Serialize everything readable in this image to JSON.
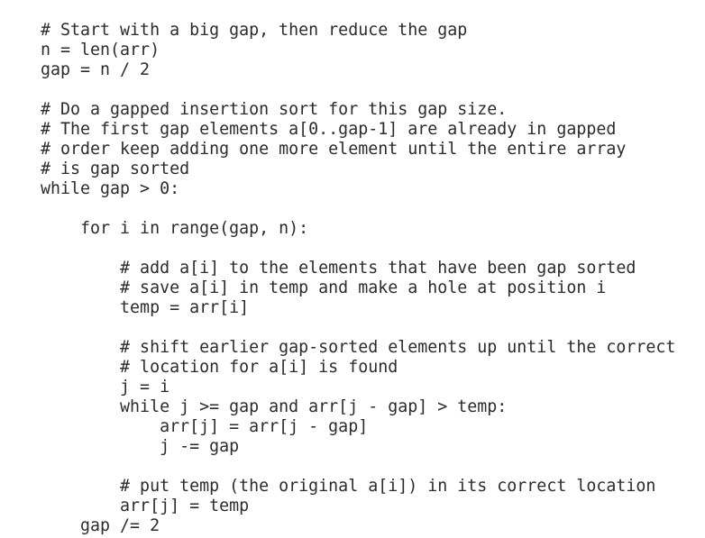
{
  "code": {
    "language": "python",
    "lines": [
      "# Start with a big gap, then reduce the gap",
      "n = len(arr)",
      "gap = n / 2",
      "",
      "# Do a gapped insertion sort for this gap size.",
      "# The first gap elements a[0..gap-1] are already in gapped",
      "# order keep adding one more element until the entire array",
      "# is gap sorted",
      "while gap > 0:",
      "",
      "    for i in range(gap, n):",
      "",
      "        # add a[i] to the elements that have been gap sorted",
      "        # save a[i] in temp and make a hole at position i",
      "        temp = arr[i]",
      "",
      "        # shift earlier gap-sorted elements up until the correct",
      "        # location for a[i] is found",
      "        j = i",
      "        while j >= gap and arr[j - gap] > temp:",
      "            arr[j] = arr[j - gap]",
      "            j -= gap",
      "",
      "        # put temp (the original a[i]) in its correct location",
      "        arr[j] = temp",
      "    gap /= 2"
    ]
  }
}
